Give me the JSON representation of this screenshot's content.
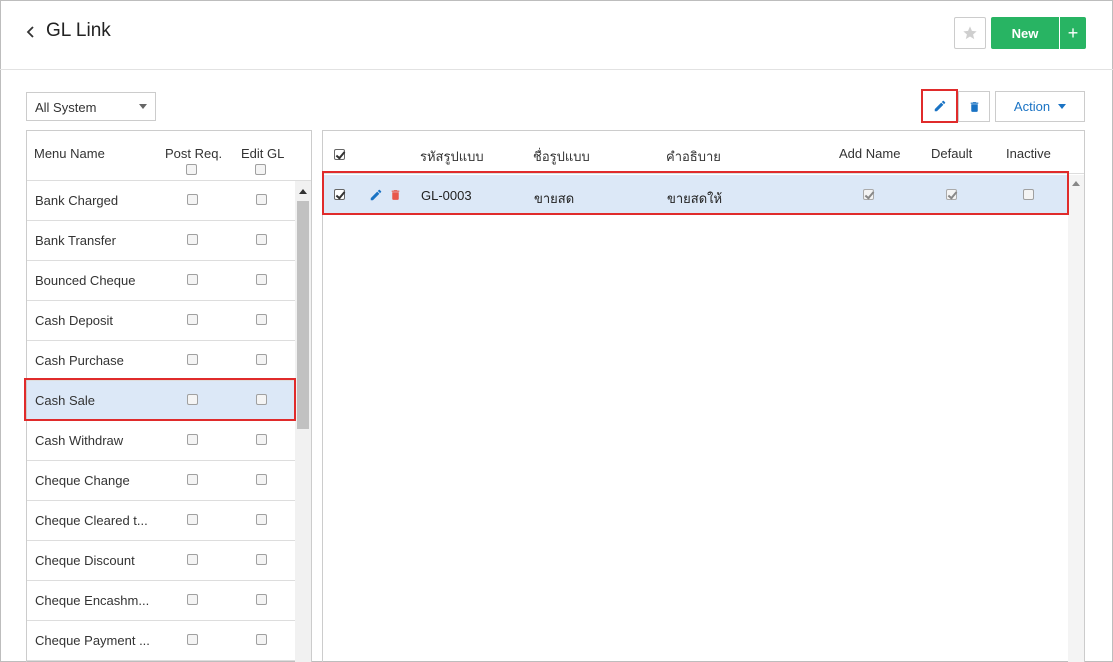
{
  "header": {
    "title": "GL Link",
    "new_label": "New",
    "plus_label": "+"
  },
  "toolbar": {
    "system_filter": "All System",
    "action_label": "Action"
  },
  "left_table": {
    "columns": [
      "Menu Name",
      "Post Req.",
      "Edit GL"
    ],
    "rows": [
      {
        "name": "Bank Charged"
      },
      {
        "name": "Bank Transfer"
      },
      {
        "name": "Bounced Cheque"
      },
      {
        "name": "Cash Deposit"
      },
      {
        "name": "Cash Purchase"
      },
      {
        "name": "Cash Sale",
        "selected": true
      },
      {
        "name": "Cash Withdraw"
      },
      {
        "name": "Cheque Change"
      },
      {
        "name": "Cheque Cleared t..."
      },
      {
        "name": "Cheque Discount"
      },
      {
        "name": "Cheque Encashm..."
      },
      {
        "name": "Cheque Payment ..."
      }
    ]
  },
  "right_table": {
    "columns": [
      "รหัสรูปแบบ",
      "ชื่อรูปแบบ",
      "คำอธิบาย",
      "Add Name",
      "Default",
      "Inactive"
    ],
    "rows": [
      {
        "code": "GL-0003",
        "name": "ขายสด",
        "description": "ขายสดให้",
        "add_name": true,
        "default": true,
        "inactive": false,
        "selected": true
      }
    ]
  },
  "colors": {
    "accent_green": "#28b463",
    "selection_blue": "#dce8f7",
    "highlight_red": "#e02b2b",
    "link_blue": "#1a73c4",
    "delete_red": "#e8574a"
  },
  "icons": [
    "chevron-left-icon",
    "star-icon",
    "plus-icon",
    "pencil-icon",
    "trash-icon",
    "caret-down-icon"
  ]
}
